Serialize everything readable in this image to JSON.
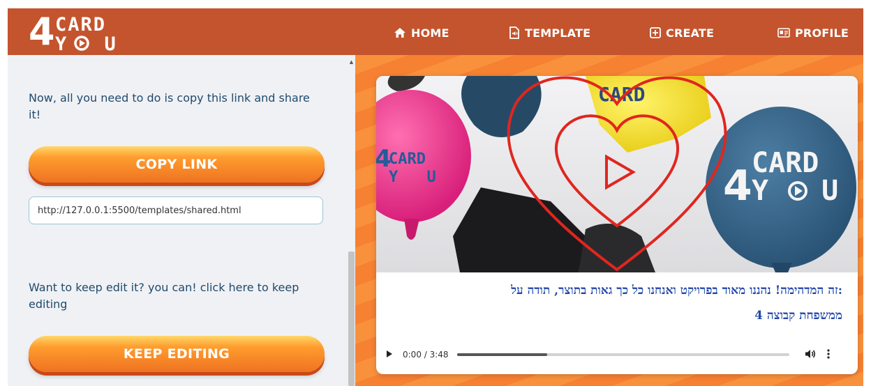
{
  "brand": {
    "logo_digit": "4",
    "logo_line1": "CARD",
    "logo_line2": "Y U"
  },
  "nav": {
    "home_label": "HOME",
    "template_label": "TEMPLATE",
    "create_label": "CREATE",
    "profile_label": "PROFILE"
  },
  "share": {
    "instructions": "Now, all you need to do is copy this link and share it!",
    "copy_button_label": "COPY LINK",
    "link_value": "http://127.0.0.1:5500/templates/shared.html",
    "keep_edit_text": "Want to keep edit it? you can! click here to keep editing",
    "keep_editing_button_label": "KEEP EDITING"
  },
  "card": {
    "caption_line1": ":זה המדהימה! נהננו מאוד בפרויקט ואנחנו כל כך גאות בתוצר, תודה על",
    "caption_line2": "ממשפחת קבוצה 4",
    "balloon_logo_digit": "4",
    "balloon_logo_line1": "CARD",
    "balloon_logo_line2": "Y U"
  },
  "audio": {
    "time_text": "0:00 / 3:48",
    "progress_fraction": 0.27
  },
  "colors": {
    "header_bg": "#c4542d",
    "panel_bg": "#f0f1f5",
    "text_blue": "#1f4a6b",
    "button_orange": "#ef7222",
    "caption_blue": "#2448a8",
    "heart_red": "#e0261f"
  }
}
